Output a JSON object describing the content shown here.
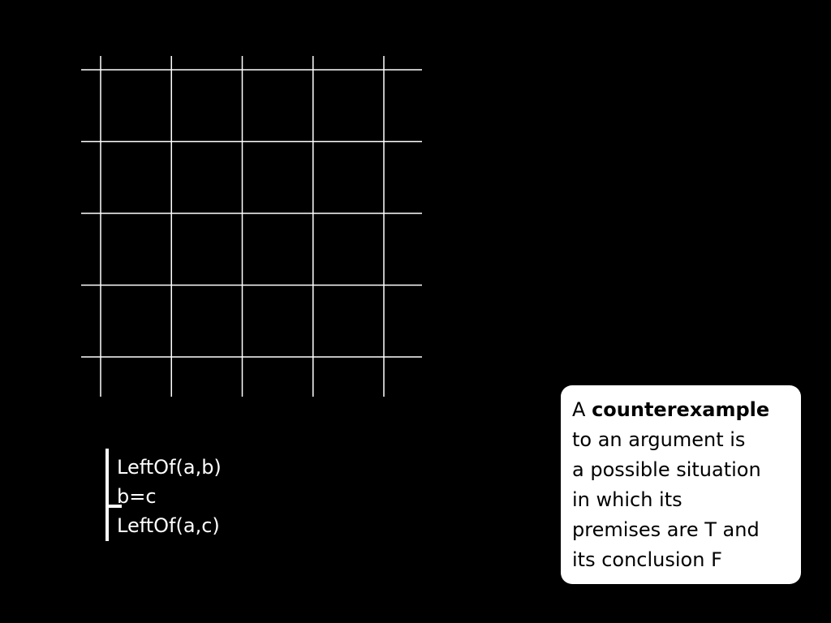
{
  "argument": {
    "premises": [
      "LeftOf(a,b)",
      "b=c"
    ],
    "conclusion": "LeftOf(a,c)"
  },
  "definition": {
    "line1_prefix": "A",
    "line1_term": "counterexample",
    "line2": "to an argument is",
    "line3": "a possible situation",
    "line4": "in which its",
    "line5": "premises are T and",
    "line6": "its conclusion F"
  },
  "grid": {
    "columns": 5,
    "rows": 5,
    "line_color": "#ffffff"
  },
  "colors": {
    "background": "#000000",
    "box_background": "#ffffff",
    "text_on_dark": "#ffffff",
    "text_on_light": "#000000"
  }
}
